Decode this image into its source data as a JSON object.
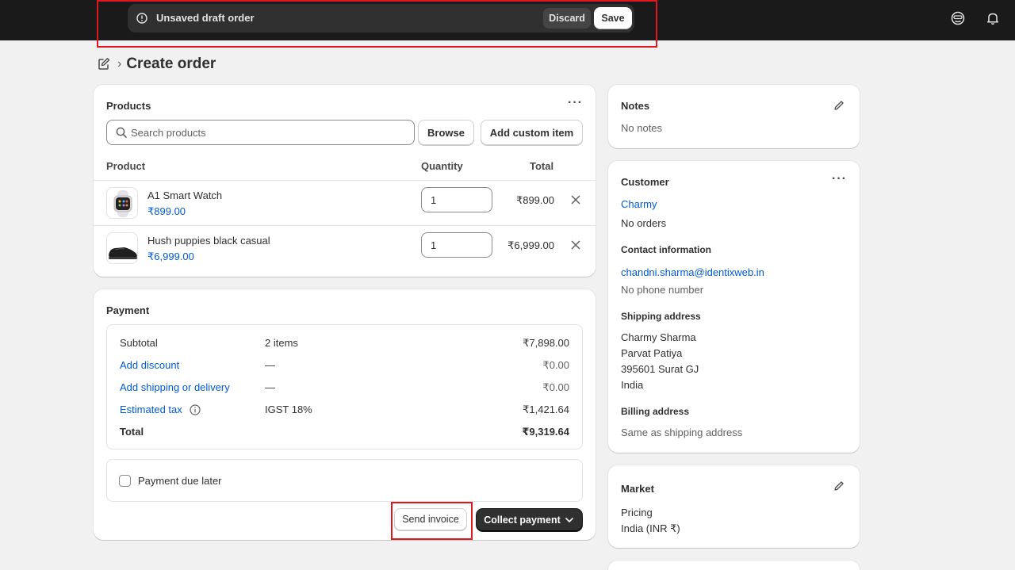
{
  "topbar": {
    "draft_message": "Unsaved draft order",
    "discard_label": "Discard",
    "save_label": "Save",
    "icons": [
      "alert-circle-icon",
      "avatar-icon",
      "bell-icon"
    ]
  },
  "page": {
    "title": "Create order",
    "breadcrumb_icon": "draft-order-icon"
  },
  "products": {
    "title": "Products",
    "search_placeholder": "Search products",
    "browse_label": "Browse",
    "add_custom_label": "Add custom item",
    "columns": [
      "Product",
      "Quantity",
      "Total"
    ],
    "items": [
      {
        "name": "A1 Smart Watch",
        "price": "₹899.00",
        "quantity": "1",
        "total": "₹899.00",
        "thumb": "watch"
      },
      {
        "name": "Hush puppies black casual",
        "price": "₹6,999.00",
        "quantity": "1",
        "total": "₹6,999.00",
        "thumb": "shoe"
      }
    ]
  },
  "payment": {
    "title": "Payment",
    "rows": [
      {
        "label": "Subtotal",
        "detail": "2 items",
        "amount": "₹7,898.00"
      },
      {
        "label": "Add discount",
        "detail": "—",
        "amount": "₹0.00"
      },
      {
        "label": "Add shipping or delivery",
        "detail": "—",
        "amount": "₹0.00"
      },
      {
        "label": "Estimated tax",
        "detail": "IGST 18%",
        "amount": "₹1,421.64"
      },
      {
        "label": "Total",
        "detail": "",
        "amount": "₹9,319.64"
      }
    ],
    "due_later_label": "Payment due later",
    "due_later_checked": false,
    "send_invoice_label": "Send invoice",
    "collect_payment_label": "Collect payment"
  },
  "notes": {
    "title": "Notes",
    "text": "No notes"
  },
  "customer": {
    "title": "Customer",
    "name": "Charmy",
    "orders": "No orders",
    "contact_heading": "Contact information",
    "email": "chandni.sharma@identixweb.in",
    "phone": "No phone number",
    "shipping_heading": "Shipping address",
    "shipping_lines": [
      "Charmy Sharma",
      "Parvat Patiya",
      "395601 Surat GJ",
      "India"
    ],
    "billing_heading": "Billing address",
    "billing_text": "Same as shipping address"
  },
  "market": {
    "title": "Market",
    "pricing_heading": "Pricing",
    "pricing_value": "India (INR ₹)"
  },
  "colors": {
    "link": "#005bd3",
    "highlight": "#e0181d",
    "topbar": "#1a1a1a",
    "primary_button": "#303030"
  }
}
